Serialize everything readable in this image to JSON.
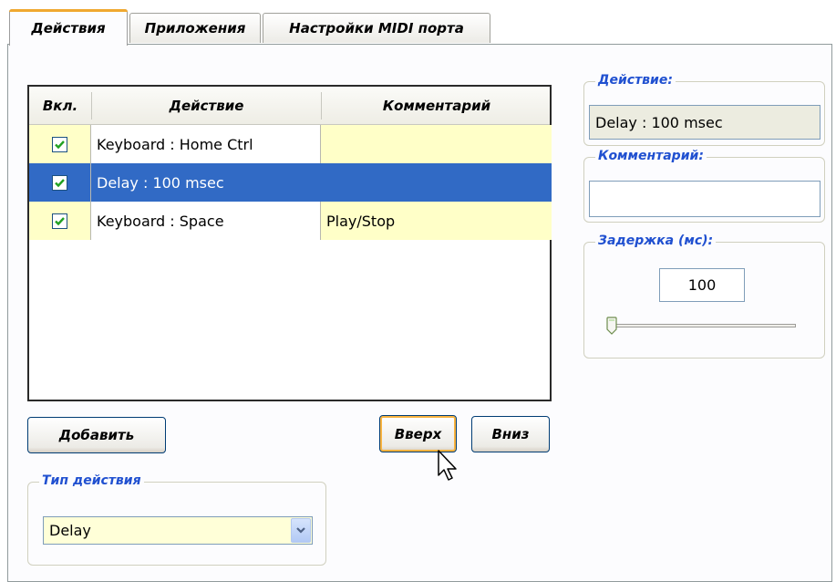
{
  "tabs": [
    {
      "label": "Действия",
      "active": true
    },
    {
      "label": "Приложения",
      "active": false
    },
    {
      "label": "Настройки MIDI порта",
      "active": false
    }
  ],
  "table": {
    "columns": [
      "Вкл.",
      "Действие",
      "Комментарий"
    ],
    "rows": [
      {
        "enabled": true,
        "action": "Keyboard : Home  Ctrl",
        "comment": "",
        "selected": false
      },
      {
        "enabled": true,
        "action": "Delay : 100 msec",
        "comment": "",
        "selected": true
      },
      {
        "enabled": true,
        "action": "Keyboard : Space",
        "comment": "Play/Stop",
        "selected": false
      }
    ]
  },
  "buttons": {
    "add": "Добавить",
    "up": "Вверх",
    "down": "Вниз"
  },
  "action_type": {
    "legend": "Тип действия",
    "selected": "Delay"
  },
  "details": {
    "action_legend": "Действие:",
    "action_value": "Delay : 100 msec",
    "comment_legend": "Комментарий:",
    "comment_value": "",
    "delay_legend": "Задержка (мс):",
    "delay_value": "100",
    "delay_slider_level": 0.02
  },
  "colors": {
    "selection": "#316ac5",
    "row_highlight": "#ffffc8",
    "legend_text": "#2050d0",
    "tab_accent": "#f0a830"
  }
}
